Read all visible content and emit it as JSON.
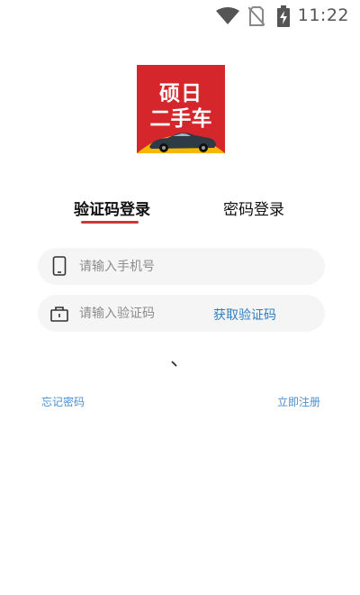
{
  "status_bar": {
    "time": "11:22",
    "icons": [
      "wifi-icon",
      "no-sim-icon",
      "battery-charging-icon"
    ]
  },
  "logo": {
    "line1": "硕日",
    "line2": "二手车",
    "colors": {
      "background": "#d5262b",
      "accent": "#f5b800"
    }
  },
  "tabs": [
    {
      "label": "验证码登录",
      "active": true
    },
    {
      "label": "密码登录",
      "active": false
    }
  ],
  "phone_field": {
    "placeholder": "请输入手机号",
    "value": "",
    "icon": "phone-icon"
  },
  "code_field": {
    "placeholder": "请输入验证码",
    "value": "",
    "icon": "lock-icon",
    "get_code_label": "获取验证码"
  },
  "links": {
    "forgot_password": "忘记密码",
    "register": "立即注册"
  },
  "colors": {
    "accent_red": "#c9383a",
    "link_blue": "#4b8fd0",
    "input_bg": "#f5f5f5"
  }
}
